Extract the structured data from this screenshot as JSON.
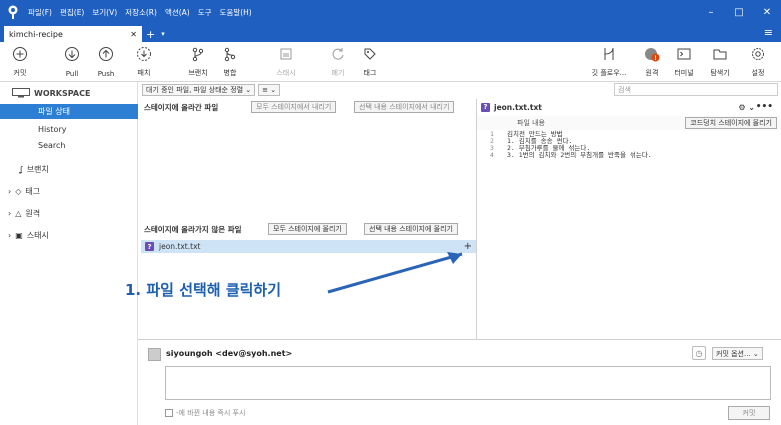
{
  "titlebar": {
    "menus": [
      "파일(F)",
      "편집(E)",
      "보기(V)",
      "저장소(R)",
      "액션(A)",
      "도구",
      "도움말(H)"
    ],
    "minimize": "–",
    "maximize": "□",
    "close": "✕"
  },
  "tabs": [
    {
      "label": "kimchi-recipe",
      "close": "✕"
    }
  ],
  "tab_add": "+",
  "tab_dropdown": "▾",
  "hamburger": "≡",
  "toolbar": {
    "commit": "커밋",
    "pull": "Pull",
    "push": "Push",
    "fetch": "패치",
    "branch": "브랜치",
    "merge": "병합",
    "stash": "스태시",
    "discard": "폐기",
    "tag": "태그",
    "git_flow": "깃 플로우...",
    "remote": "원격",
    "terminal": "터미널",
    "explorer": "탐색기",
    "settings": "설정"
  },
  "sidebar": {
    "workspace": "WORKSPACE",
    "items": [
      {
        "label": "파일 상태"
      },
      {
        "label": "History"
      },
      {
        "label": "Search"
      }
    ],
    "branches": "브랜치",
    "tags": "태그",
    "remotes": "원격",
    "stashes": "스태시"
  },
  "filter": {
    "pending": "대기 중인 파일, 파일 상태순 정렬",
    "view": "≡"
  },
  "search": {
    "placeholder": "검색"
  },
  "staged": {
    "title": "스테이지에 올라간 파일",
    "unstage_all": "모두 스테이지에서 내리기",
    "unstage_sel": "선택 내용 스테이지에서 내리기"
  },
  "unstaged": {
    "title": "스테이지에 올라가지 않은 파일",
    "stage_all": "모두 스테이지에 올리기",
    "stage_sel": "선택 내용 스테이지에 올리기",
    "files": [
      {
        "name": "jeon.txt.txt",
        "status": "?"
      }
    ]
  },
  "diff": {
    "filename": "jeon.txt.txt",
    "section": "파일 내용",
    "stage_hunk": "코드덩치 스테이지에 올리기",
    "lines": [
      {
        "n": "1",
        "text": "김치전 만드는 방법"
      },
      {
        "n": "2",
        "text": "1. 김치를 송송 썬다."
      },
      {
        "n": "3",
        "text": "2. 부침가루를 물에 섞는다."
      },
      {
        "n": "4",
        "text": "3. 1번의 김치와 2번의 부침개를 반죽을 섞는다."
      }
    ]
  },
  "commit": {
    "author": "siyoungoh <dev@syoh.net>",
    "options": "커밋 옵션...",
    "push_label": "-에 바뀐 내용 즉시 푸시",
    "commit_btn": "커밋"
  },
  "annotation": {
    "num": "1.",
    "text": "파일 선택해 클릭하기"
  }
}
